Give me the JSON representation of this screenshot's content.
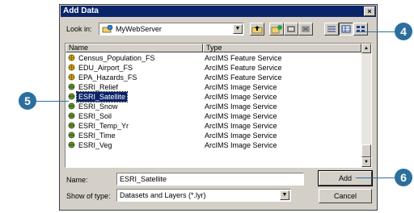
{
  "window": {
    "title": "Add Data",
    "close_glyph": "×"
  },
  "look_in": {
    "label": "Look in:",
    "value": "MyWebServer"
  },
  "toolbar": [
    "folder-up-icon",
    "connect-server-icon",
    "toc-icon",
    "delete-icon",
    "list-view-icon",
    "details-view-icon",
    "thumbnail-view-icon"
  ],
  "columns": {
    "name": "Name",
    "type": "Type"
  },
  "rows": [
    {
      "name": "Census_Population_FS",
      "type": "ArcIMS Feature Service"
    },
    {
      "name": "EDU_Airport_FS",
      "type": "ArcIMS Feature Service"
    },
    {
      "name": "EPA_Hazards_FS",
      "type": "ArcIMS Feature Service"
    },
    {
      "name": "ESRI_Relief",
      "type": "ArcIMS Image Service"
    },
    {
      "name": "ESRI_Satellite",
      "type": "ArcIMS Image Service"
    },
    {
      "name": "ESRI_Snow",
      "type": "ArcIMS Image Service"
    },
    {
      "name": "ESRI_Soil",
      "type": "ArcIMS Image Service"
    },
    {
      "name": "ESRI_Temp_Yr",
      "type": "ArcIMS Image Service"
    },
    {
      "name": "ESRI_Time",
      "type": "ArcIMS Image Service"
    },
    {
      "name": "ESRI_Veg",
      "type": "ArcIMS Image Service"
    }
  ],
  "name_field": {
    "label": "Name:",
    "value": "ESRI_Satellite"
  },
  "show_type": {
    "label": "Show of type:",
    "value": "Datasets and Layers (*.lyr)"
  },
  "buttons": {
    "add": "Add",
    "cancel": "Cancel"
  },
  "callouts": {
    "c4": "4",
    "c5": "5",
    "c6": "6"
  },
  "colors": {
    "title_bar": "#0a246a",
    "callout": "#2c6f9e",
    "dialog": "#d4d0c8"
  }
}
